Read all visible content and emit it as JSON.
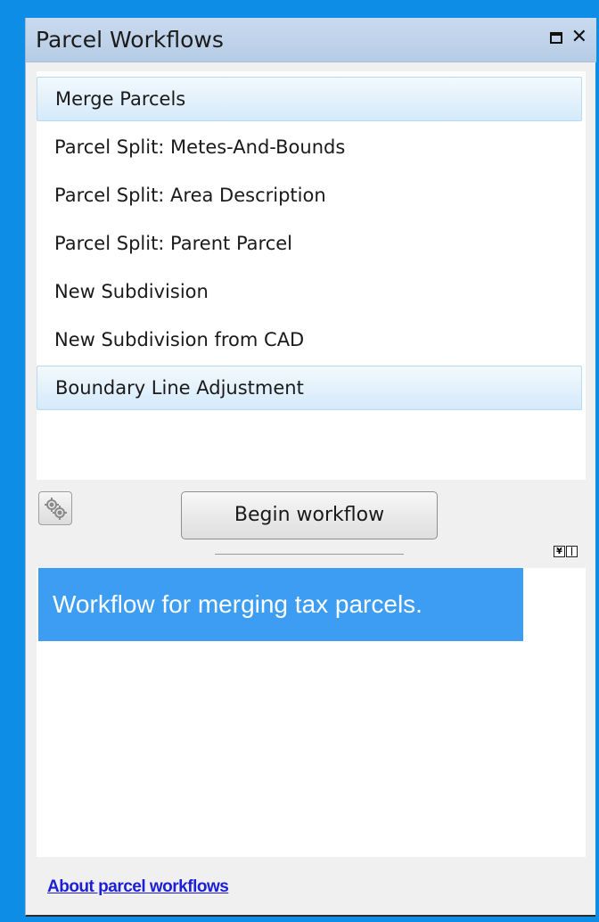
{
  "window": {
    "title": "Parcel Workflows",
    "maximize_icon": "maximize-icon",
    "close_icon": "close-icon"
  },
  "workflows": {
    "items": [
      {
        "label": "Merge Parcels",
        "highlighted": true
      },
      {
        "label": "Parcel Split: Metes-And-Bounds",
        "highlighted": false
      },
      {
        "label": "Parcel Split: Area Description",
        "highlighted": false
      },
      {
        "label": "Parcel Split: Parent Parcel",
        "highlighted": false
      },
      {
        "label": "New Subdivision",
        "highlighted": false
      },
      {
        "label": "New Subdivision from CAD",
        "highlighted": false
      },
      {
        "label": "Boundary Line Adjustment",
        "highlighted": true
      }
    ]
  },
  "toolbar": {
    "settings_icon": "gear-icon",
    "begin_label": "Begin workflow"
  },
  "description": {
    "text": "Workflow for merging tax parcels."
  },
  "footer": {
    "about_link": "About parcel workflows"
  },
  "colors": {
    "background": "#0d8de6",
    "selection": "#3d9df2",
    "link": "#1c1fd6"
  }
}
